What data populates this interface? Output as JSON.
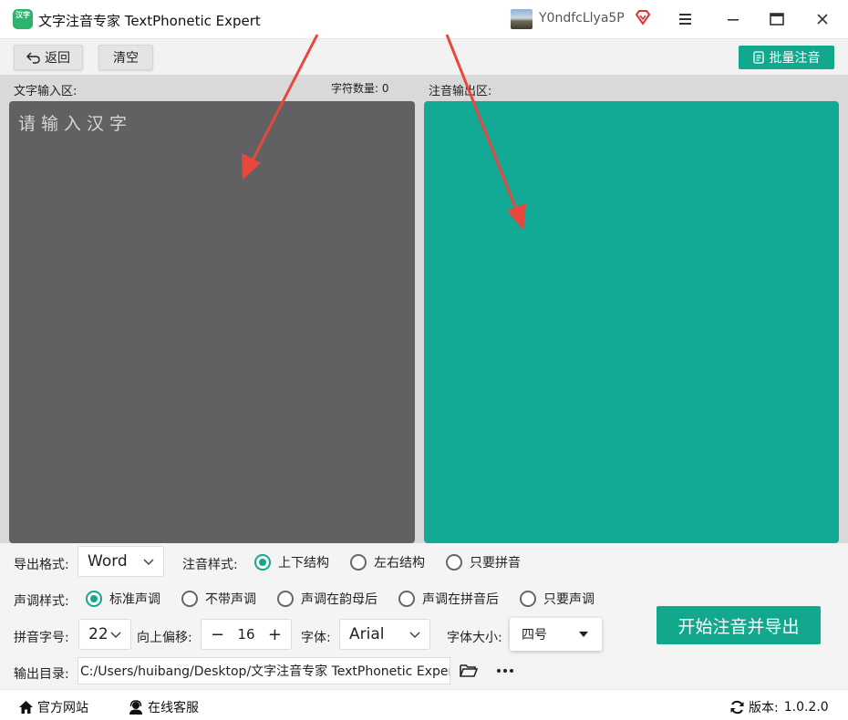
{
  "window": {
    "title": "文字注音专家 TextPhonetic Expert",
    "logo_text": "汉字",
    "username": "Y0ndfcLlya5P"
  },
  "toolbar": {
    "back_label": "返回",
    "clear_label": "清空",
    "batch_label": "批量注音"
  },
  "editor": {
    "input_label": "文字输入区:",
    "char_count_label": "字符数量:",
    "char_count_value": "0",
    "input_placeholder": "请输入汉字",
    "output_label": "注音输出区:"
  },
  "settings": {
    "export_format_label": "导出格式:",
    "export_format_value": "Word",
    "annotation_style_label": "注音样式:",
    "annotation_styles": [
      {
        "label": "上下结构",
        "selected": true
      },
      {
        "label": "左右结构",
        "selected": false
      },
      {
        "label": "只要拼音",
        "selected": false
      }
    ],
    "tone_style_label": "声调样式:",
    "tone_styles": [
      {
        "label": "标准声调",
        "selected": true
      },
      {
        "label": "不带声调",
        "selected": false
      },
      {
        "label": "声调在韵母后",
        "selected": false
      },
      {
        "label": "声调在拼音后",
        "selected": false
      },
      {
        "label": "只要声调",
        "selected": false
      }
    ],
    "pinyin_size_label": "拼音字号:",
    "pinyin_size_value": "22",
    "offset_label": "向上偏移:",
    "offset_value": "16",
    "font_label": "字体:",
    "font_value": "Arial",
    "font_size_label": "字体大小:",
    "font_size_value": "四号",
    "start_label": "开始注音并导出",
    "output_dir_label": "输出目录:",
    "output_dir_value": "C:/Users/huibang/Desktop/文字注音专家 TextPhonetic Expert"
  },
  "statusbar": {
    "website_label": "官方网站",
    "support_label": "在线客服",
    "version_label": "版本:",
    "version_value": "1.0.2.0"
  },
  "colors": {
    "accent": "#12a88e",
    "input_bg": "#616164",
    "output_bg": "#12aa95",
    "annotation_arrow": "#e8483c"
  }
}
